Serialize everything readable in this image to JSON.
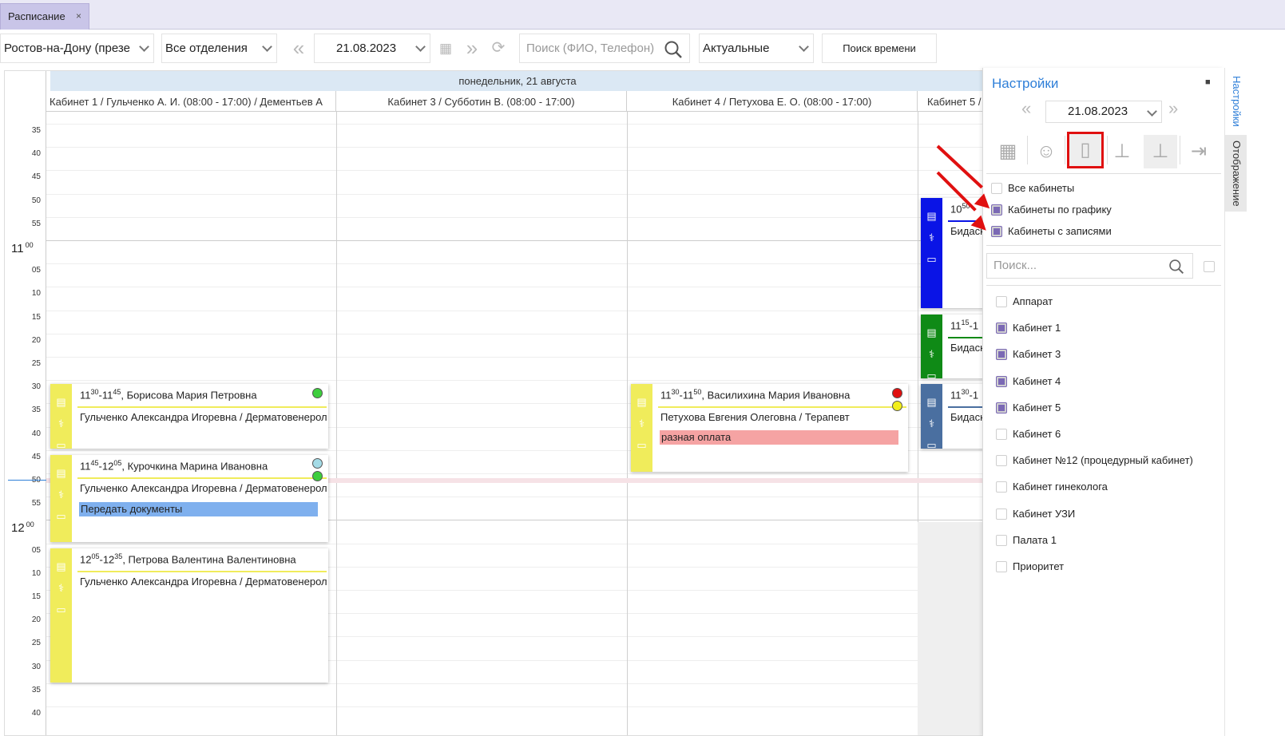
{
  "tab": {
    "title": "Расписание",
    "close": "×"
  },
  "toolbar": {
    "branch": "Ростов-на-Дону (презе",
    "department": "Все отделения",
    "date": "21.08.2023",
    "search_placeholder": "Поиск (ФИО, Телефон)",
    "status_filter": "Актуальные",
    "find_time_label": "Поиск времени"
  },
  "calendar": {
    "day_title": "понедельник, 21 августа",
    "columns": [
      "Кабинет 1 / Гульченко А. И. (08:00 - 17:00) / Дементьев А",
      "Кабинет 3 / Субботин В.  (08:00 - 17:00)",
      "Кабинет 4 / Петухова Е. О. (08:00 - 17:00)",
      "Кабинет 5 / "
    ],
    "minute_labels": [
      "35",
      "40",
      "45",
      "50",
      "55",
      "",
      "05",
      "10",
      "15",
      "20",
      "25",
      "30",
      "35",
      "40",
      "45",
      "50",
      "55",
      "",
      "05",
      "10",
      "15",
      "20",
      "25",
      "30",
      "35",
      "40"
    ],
    "hour_11": "11",
    "hour_12": "12",
    "hour_minutes": "00"
  },
  "appointments": [
    {
      "time_start": "11",
      "start_min": "30",
      "sep": "-",
      "time_end": "11",
      "end_min": "45",
      "patient": ", Борисова Мария Петровна",
      "doctor": "Гульченко Александра Игоревна / Дерматовенерол",
      "note": "",
      "color": "#f0ec5b"
    },
    {
      "time_start": "11",
      "start_min": "45",
      "sep": "-",
      "time_end": "12",
      "end_min": "05",
      "patient": ", Курочкина Марина Ивановна",
      "doctor": "Гульченко Александра Игоревна / Дерматовенерол",
      "note": "Передать документы",
      "color": "#f0ec5b"
    },
    {
      "time_start": "12",
      "start_min": "05",
      "sep": "-",
      "time_end": "12",
      "end_min": "35",
      "patient": ", Петрова Валентина Валентиновна",
      "doctor": "Гульченко Александра Игоревна / Дерматовенерол",
      "note": "",
      "color": "#f0ec5b"
    },
    {
      "time_start": "11",
      "start_min": "30",
      "sep": "-",
      "time_end": "11",
      "end_min": "50",
      "patient": ", Василихина Мария Ивановна",
      "doctor": "Петухова Евгения Олеговна / Терапевт",
      "note": "разная оплата",
      "color": "#f0ec5b"
    },
    {
      "time_start": "10",
      "start_min": "50",
      "sep": "",
      "time_end": "",
      "end_min": "",
      "patient": "",
      "doctor": "Бидаски",
      "note": "",
      "color": "#0a14e6"
    },
    {
      "time_start": "11",
      "start_min": "15",
      "sep": "-1",
      "time_end": "",
      "end_min": "",
      "patient": "",
      "doctor": "Бидаски",
      "note": "",
      "color": "#0f8a16"
    },
    {
      "time_start": "11",
      "start_min": "30",
      "sep": "-1",
      "time_end": "",
      "end_min": "",
      "patient": "",
      "doctor": "Бидаски",
      "note": "",
      "color": "#4a6fa0"
    }
  ],
  "settings": {
    "title": "Настройки",
    "pin": "■",
    "date": "21.08.2023",
    "options": [
      {
        "label": "Все кабинеты",
        "checked": false
      },
      {
        "label": "Кабинеты по графику",
        "checked": true
      },
      {
        "label": "Кабинеты с записями",
        "checked": true
      }
    ],
    "search_placeholder": "Поиск...",
    "rooms": [
      {
        "label": "Аппарат",
        "checked": false
      },
      {
        "label": "Кабинет 1",
        "checked": true
      },
      {
        "label": "Кабинет 3",
        "checked": true
      },
      {
        "label": "Кабинет 4",
        "checked": true
      },
      {
        "label": "Кабинет 5",
        "checked": true
      },
      {
        "label": "Кабинет 6",
        "checked": false
      },
      {
        "label": "Кабинет №12 (процедурный кабинет)",
        "checked": false
      },
      {
        "label": "Кабинет гинеколога",
        "checked": false
      },
      {
        "label": "Кабинет УЗИ",
        "checked": false
      },
      {
        "label": "Палата 1",
        "checked": false
      },
      {
        "label": "Приоритет",
        "checked": false
      }
    ]
  },
  "side_tabs": {
    "settings": "Настройки",
    "display": "Отображение"
  },
  "icons": {
    "prev": "double-chevron-left-icon",
    "next": "double-chevron-right-icon",
    "calendar": "calendar-icon",
    "refresh": "refresh-icon",
    "search": "search-icon"
  },
  "colors": {
    "accent": "#7b69b5",
    "link": "#2f7fd8",
    "highlight_box": "#e01010",
    "note_red": "#f5a3a3",
    "note_blue": "#7fb0ee"
  }
}
